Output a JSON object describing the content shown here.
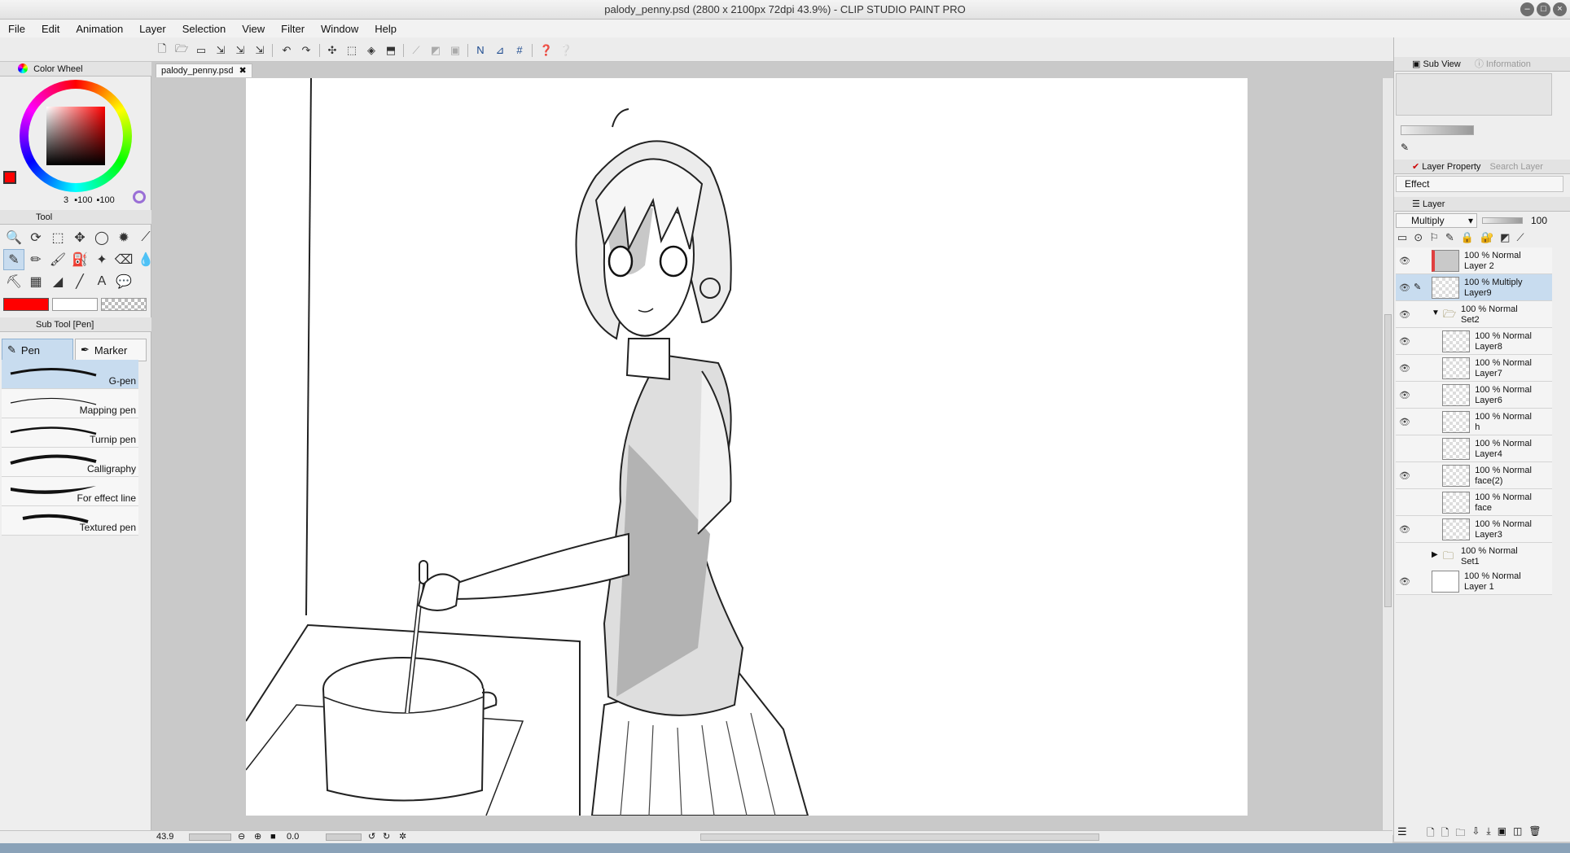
{
  "window": {
    "title": "palody_penny.psd (2800 x 2100px 72dpi 43.9%)  - CLIP STUDIO PAINT PRO"
  },
  "menu": [
    "File",
    "Edit",
    "Animation",
    "Layer",
    "Selection",
    "View",
    "Filter",
    "Window",
    "Help"
  ],
  "left_panel": {
    "color_wheel_tab": "Color Wheel",
    "color_readout": [
      "3",
      "100",
      "100"
    ],
    "main_color": "#ff0000",
    "tool_tab": "Tool",
    "subtool_tab": "Sub Tool [Pen]",
    "subtool_groups": [
      "Pen",
      "Marker"
    ],
    "brushes": [
      "G-pen",
      "Mapping pen",
      "Turnip pen",
      "Calligraphy",
      "For effect line",
      "Textured pen"
    ]
  },
  "canvas": {
    "doc_tab": "palody_penny.psd"
  },
  "status": {
    "zoom": "43.9",
    "angle": "0.0"
  },
  "right_panel": {
    "subview_tab": "Sub View",
    "information_tab": "Information",
    "layer_property_tab": "Layer Property",
    "search_layer_tab": "Search Layer",
    "effect_label": "Effect",
    "layer_tab": "Layer",
    "blend_mode": "Multiply",
    "opacity": "100",
    "layers": [
      {
        "opacity": "100 %",
        "mode": "Normal",
        "name": "Layer 2",
        "indent": 0,
        "type": "layer",
        "visible": true,
        "selected": false
      },
      {
        "opacity": "100 %",
        "mode": "Multiply",
        "name": "Layer9",
        "indent": 0,
        "type": "layer",
        "visible": true,
        "selected": true
      },
      {
        "opacity": "100 %",
        "mode": "Normal",
        "name": "Set2",
        "indent": 0,
        "type": "folder-open",
        "visible": true,
        "selected": false
      },
      {
        "opacity": "100 %",
        "mode": "Normal",
        "name": "Layer8",
        "indent": 1,
        "type": "layer",
        "visible": true,
        "selected": false
      },
      {
        "opacity": "100 %",
        "mode": "Normal",
        "name": "Layer7",
        "indent": 1,
        "type": "layer",
        "visible": true,
        "selected": false
      },
      {
        "opacity": "100 %",
        "mode": "Normal",
        "name": "Layer6",
        "indent": 1,
        "type": "layer",
        "visible": true,
        "selected": false
      },
      {
        "opacity": "100 %",
        "mode": "Normal",
        "name": "h",
        "indent": 1,
        "type": "layer",
        "visible": true,
        "selected": false
      },
      {
        "opacity": "100 %",
        "mode": "Normal",
        "name": "Layer4",
        "indent": 1,
        "type": "layer",
        "visible": false,
        "selected": false
      },
      {
        "opacity": "100 %",
        "mode": "Normal",
        "name": "face(2)",
        "indent": 1,
        "type": "layer",
        "visible": true,
        "selected": false
      },
      {
        "opacity": "100 %",
        "mode": "Normal",
        "name": "face",
        "indent": 1,
        "type": "layer",
        "visible": false,
        "selected": false
      },
      {
        "opacity": "100 %",
        "mode": "Normal",
        "name": "Layer3",
        "indent": 1,
        "type": "layer",
        "visible": true,
        "selected": false
      },
      {
        "opacity": "100 %",
        "mode": "Normal",
        "name": "Set1",
        "indent": 0,
        "type": "folder-closed",
        "visible": false,
        "selected": false
      },
      {
        "opacity": "100 %",
        "mode": "Normal",
        "name": "Layer 1",
        "indent": 0,
        "type": "layer",
        "visible": true,
        "selected": false
      }
    ]
  }
}
